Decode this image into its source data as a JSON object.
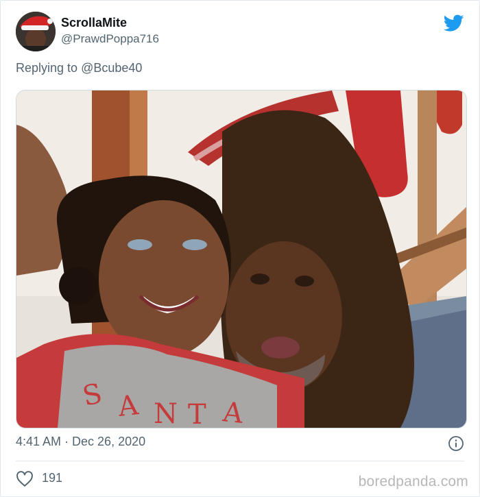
{
  "tweet": {
    "author_name": "ScrollaMite",
    "author_handle": "@PrawdPoppa716",
    "reply_prefix": "Replying to",
    "reply_to": "@Bcube40",
    "timestamp": "4:41 AM · Dec 26, 2020",
    "like_count": "191"
  },
  "watermark": "boredpanda.com",
  "icons": {
    "brand": "twitter-bird-icon",
    "info": "info-icon",
    "like": "heart-icon"
  },
  "colors": {
    "twitter_blue": "#1d9bf0",
    "secondary_text": "#536471",
    "primary_text": "#0f1419"
  }
}
